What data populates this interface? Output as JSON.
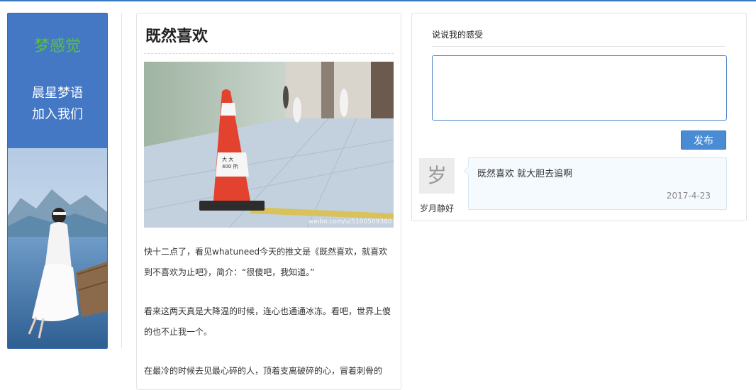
{
  "sidebar": {
    "brand": "梦感觉",
    "links": [
      {
        "label": "晨星梦语"
      },
      {
        "label": "加入我们"
      }
    ]
  },
  "article": {
    "title": "既然喜欢",
    "paragraphs": [
      "快十二点了，看见whatuneed今天的推文是《既然喜欢，就喜欢到不喜欢为止吧》，简介：“很傻吧，我知道。”",
      "看来这两天真是大降温的时候，连心也通通冰冻。看吧，世界上傻的也不止我一个。",
      "在最冷的时候去见最心碎的人，顶着支离破碎的心，冒着刺骨的"
    ],
    "watermark": "weibo.com/u/5100509380"
  },
  "comments": {
    "heading": "说说我的感受",
    "input_value": "",
    "post_label": "发布",
    "items": [
      {
        "avatar_char": "岁",
        "username": "岁月静好",
        "text": "既然喜欢 就大胆去追啊",
        "date": "2017-4-23"
      }
    ]
  },
  "colors": {
    "accent": "#3a78c3",
    "sidebar_bg": "#4477c4",
    "brand_green": "#58c143",
    "button_bg": "#4a8cd3"
  }
}
